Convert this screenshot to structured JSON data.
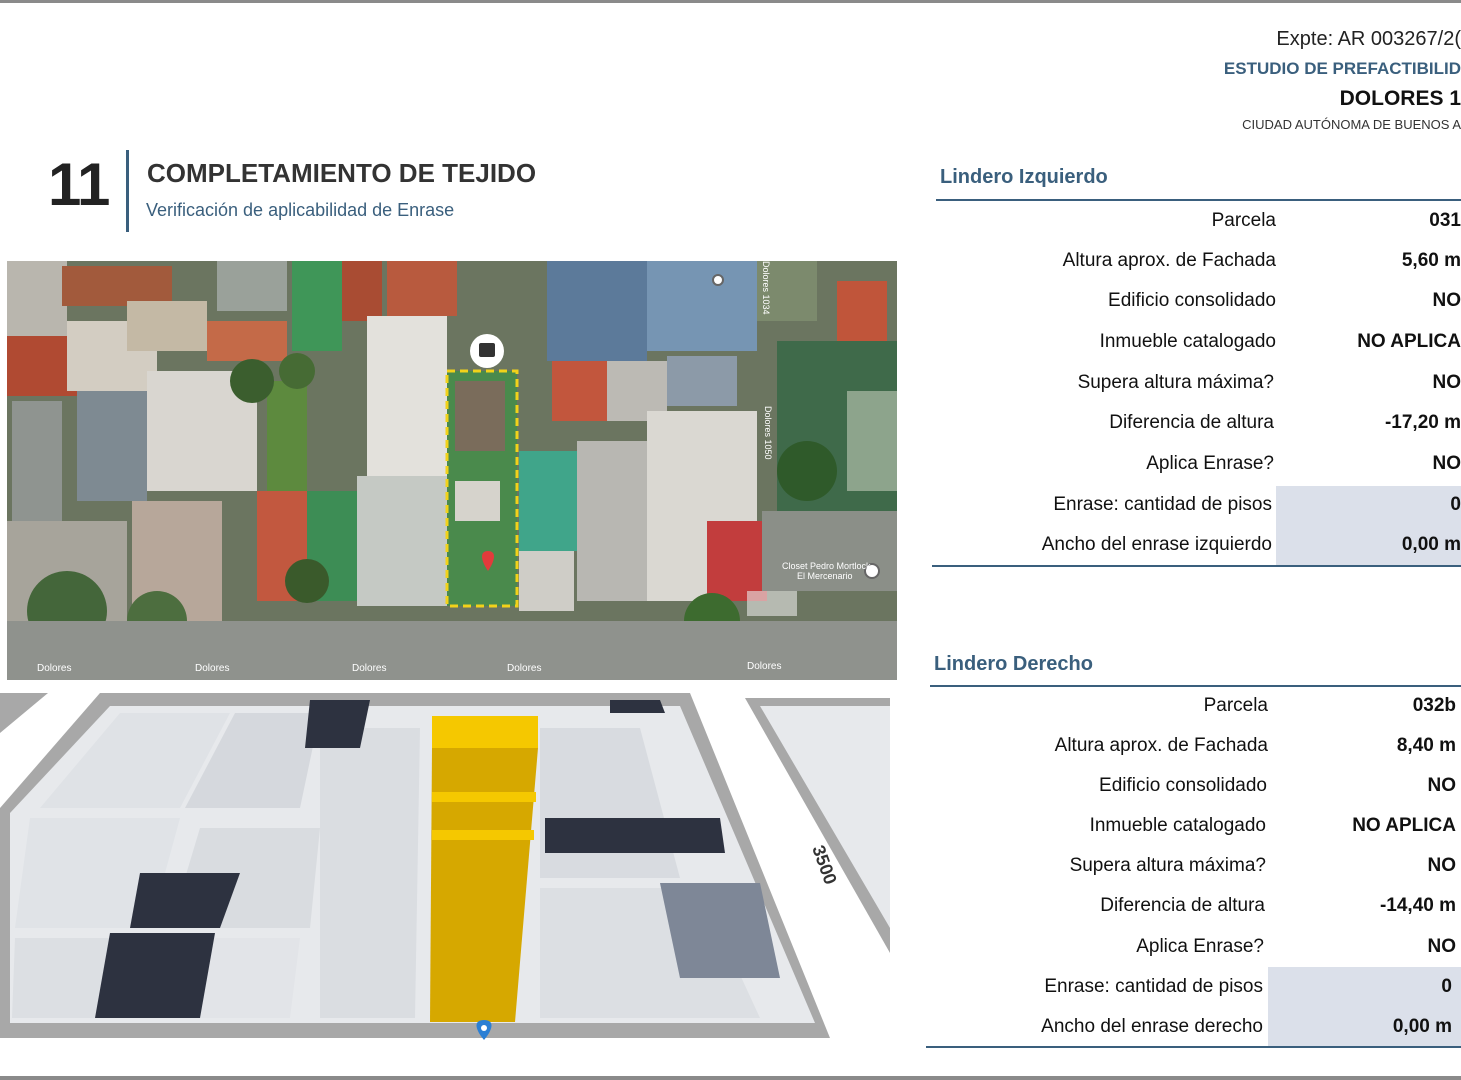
{
  "header": {
    "expediente": "Expte: AR 003267/2(",
    "estudio": "ESTUDIO DE PREFACTIBILID",
    "direccion": "DOLORES 1",
    "ciudad": "CIUDAD AUTÓNOMA DE BUENOS A"
  },
  "section": {
    "number": "11",
    "title": "COMPLETAMIENTO DE TEJIDO",
    "subtitle": "Verificación de aplicabilidad de Enrase"
  },
  "aerial": {
    "street_labels": [
      "Dolores",
      "Dolores",
      "Dolores",
      "Dolores",
      "Dolores"
    ],
    "poi_1": "Dolores 1034",
    "poi_2": "Dolores 1050",
    "poi_3": "Closet Pedro Mortlock",
    "poi_3b": "El Mercenario",
    "plot_outline_color": "#f2d21a",
    "pin_color": "#e23b3b"
  },
  "model": {
    "street_number": "3500",
    "tower_color": "#d6a800",
    "tower_top_color": "#f5c800",
    "pin_color": "#2b7fd4"
  },
  "lindero_izquierdo": {
    "title": "Lindero Izquierdo",
    "rows": [
      {
        "label": "Parcela",
        "value": "031"
      },
      {
        "label": "Altura aprox. de Fachada",
        "value": "5,60 m"
      },
      {
        "label": "Edificio consolidado",
        "value": "NO"
      },
      {
        "label": "Inmueble catalogado",
        "value": "NO APLICA"
      },
      {
        "label": "Supera altura máxima?",
        "value": "NO"
      },
      {
        "label": "Diferencia de altura",
        "value": "-17,20 m"
      },
      {
        "label": "Aplica Enrase?",
        "value": "NO"
      },
      {
        "label": "Enrase: cantidad de pisos",
        "value": "0"
      },
      {
        "label": "Ancho del enrase izquierdo",
        "value": "0,00 m"
      }
    ]
  },
  "lindero_derecho": {
    "title": "Lindero Derecho",
    "rows": [
      {
        "label": "Parcela",
        "value": "032b"
      },
      {
        "label": "Altura aprox. de Fachada",
        "value": "8,40 m"
      },
      {
        "label": "Edificio consolidado",
        "value": "NO"
      },
      {
        "label": "Inmueble catalogado",
        "value": "NO APLICA"
      },
      {
        "label": "Supera altura máxima?",
        "value": "NO"
      },
      {
        "label": "Diferencia de altura",
        "value": "-14,40 m"
      },
      {
        "label": "Aplica Enrase?",
        "value": "NO"
      },
      {
        "label": "Enrase: cantidad de pisos",
        "value": "0"
      },
      {
        "label": "Ancho del enrase derecho",
        "value": "0,00 m"
      }
    ]
  },
  "colors": {
    "accent": "#3a5f7d",
    "shade": "#dbe0ea"
  }
}
